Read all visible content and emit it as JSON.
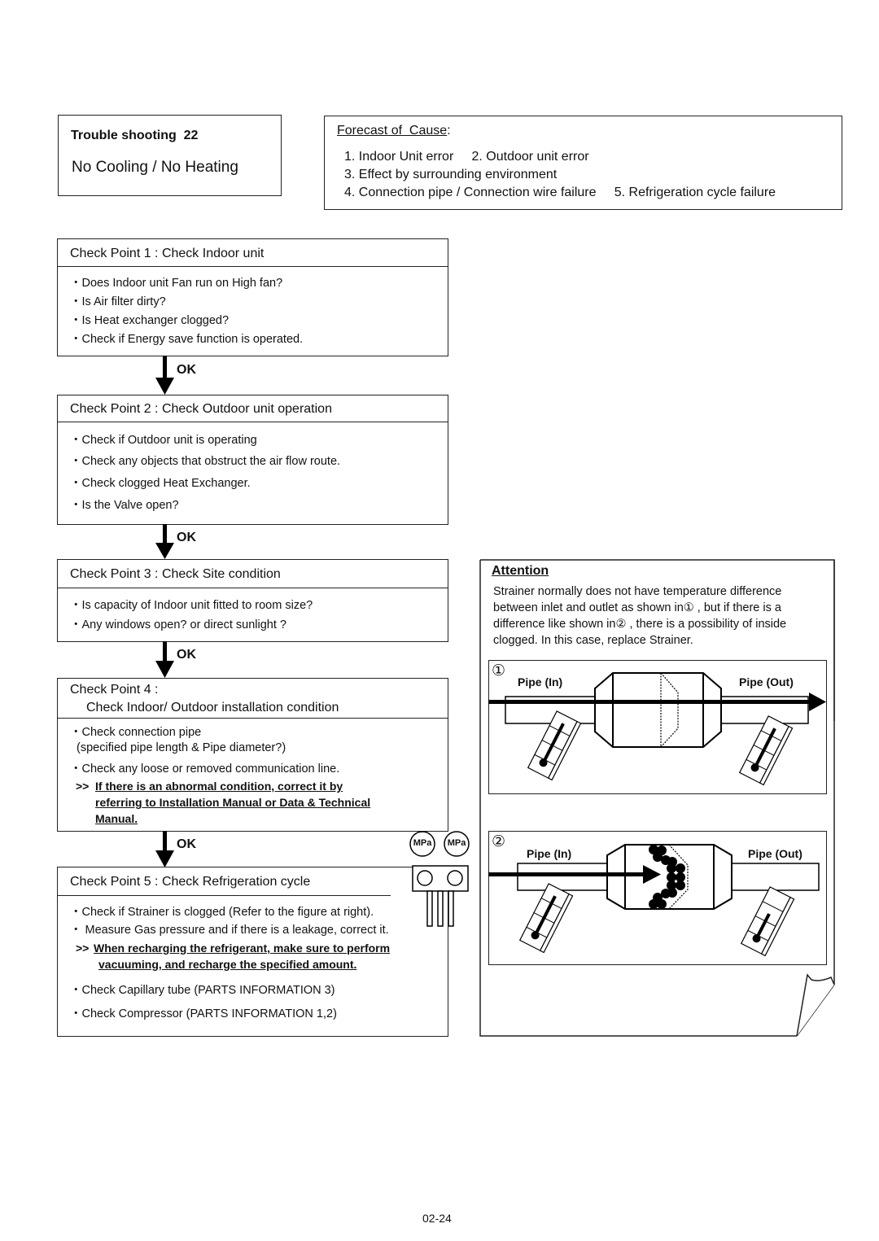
{
  "header": {
    "title": "Trouble shooting  22",
    "subtitle": "No Cooling / No Heating"
  },
  "forecast": {
    "title": "Forecast of  Cause",
    "colon": ":",
    "lines": [
      "1. Indoor Unit error     2. Outdoor unit error",
      "3. Effect by surrounding environment",
      "4. Connection pipe / Connection wire failure     5. Refrigeration cycle failure"
    ]
  },
  "check_points": [
    {
      "title": "Check Point 1 : Check Indoor unit",
      "items": [
        "・Does Indoor unit Fan run on High fan?",
        "・Is Air filter dirty?",
        "・Is Heat exchanger clogged?",
        "・Check if Energy save function is operated."
      ]
    },
    {
      "title": "Check Point 2 : Check Outdoor unit operation",
      "items": [
        "・Check if Outdoor unit is operating",
        "・Check any objects that obstruct the air flow route.",
        "・Check clogged Heat Exchanger.",
        "・Is the Valve open?"
      ]
    },
    {
      "title": "Check Point 3 : Check Site condition",
      "items": [
        "・Is capacity of Indoor unit fitted to room size?",
        "・Any windows open? or direct sunlight ?"
      ]
    },
    {
      "title_line1": "Check Point 4 :",
      "title_line2": "Check Indoor/ Outdoor installation condition",
      "items": [
        "・Check connection pipe",
        " (specified pipe length & Pipe diameter?)",
        "・Check any loose or removed communication line."
      ],
      "note_prefix": ">>",
      "note_lines": [
        "If there is an abnormal condition, correct it by",
        "referring to Installation Manual or Data & Technical",
        "Manual."
      ]
    },
    {
      "title": "Check Point 5 : Check Refrigeration cycle",
      "items": [
        "・Check if Strainer is clogged (Refer to the figure at right).",
        "・ Measure Gas pressure and if there is a leakage, correct it."
      ],
      "note_prefix": ">>",
      "note_lines": [
        "When recharging the refrigerant, make sure to perform",
        "vacuuming, and recharge the specified amount."
      ],
      "items_after": [
        "・Check Capillary tube (PARTS INFORMATION 3)",
        "・Check Compressor (PARTS INFORMATION 1,2)"
      ]
    }
  ],
  "flow_label": "OK",
  "gauge": {
    "label": "MPa"
  },
  "attention": {
    "title": "Attention",
    "lines": [
      "Strainer normally does not have temperature difference",
      "between inlet and outlet as shown in① , but if there is a",
      "difference like shown in② , there is a possibility of inside",
      "clogged. In this case, replace Strainer."
    ],
    "figure1": {
      "marker": "①",
      "pipe_in": "Pipe (In)",
      "pipe_out": "Pipe (Out)"
    },
    "figure2": {
      "marker": "②",
      "pipe_in": "Pipe (In)",
      "pipe_out": "Pipe (Out)"
    }
  },
  "footer": {
    "page_number": "02-24"
  }
}
